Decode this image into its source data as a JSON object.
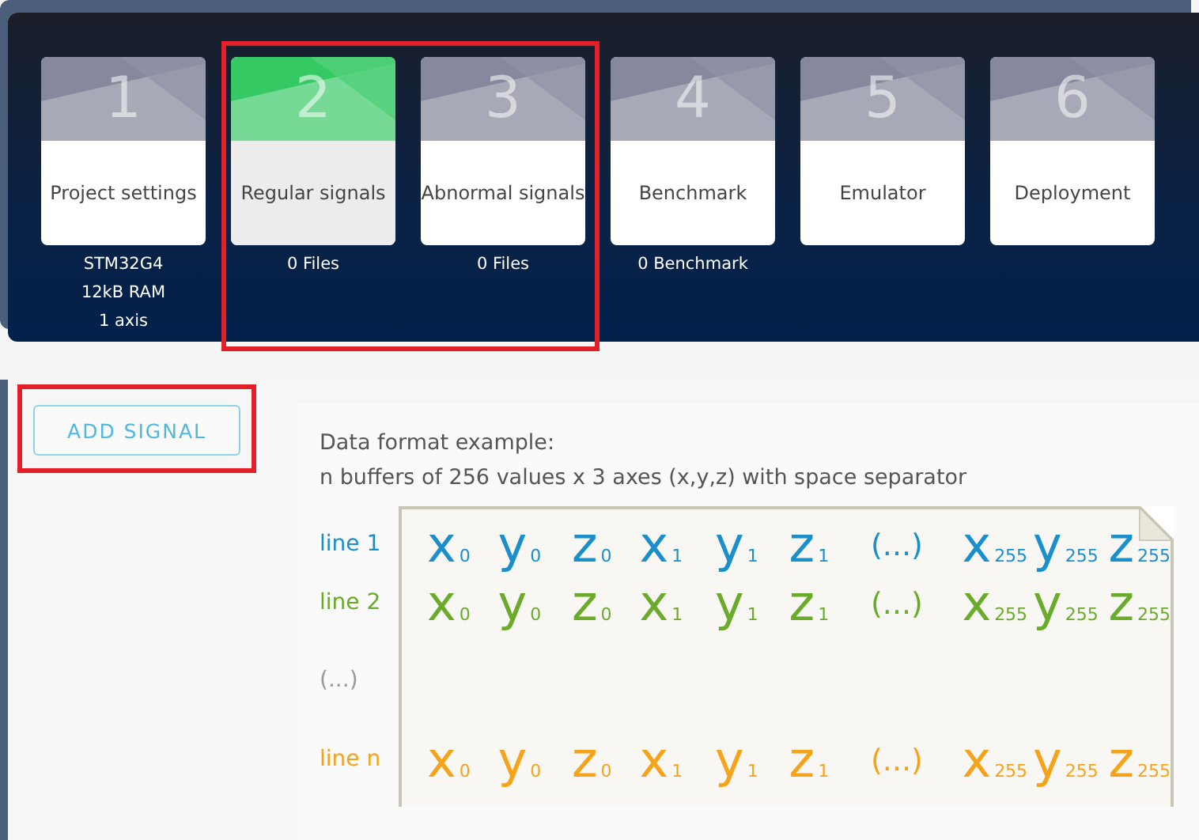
{
  "steps": [
    {
      "number": "1",
      "title": "Project settings",
      "selected": false,
      "highlighted": false,
      "details": [
        "STM32G4",
        "12kB RAM",
        "1 axis"
      ]
    },
    {
      "number": "2",
      "title": "Regular signals",
      "selected": true,
      "highlighted": true,
      "details": [
        "0 Files"
      ]
    },
    {
      "number": "3",
      "title": "Abnormal signals",
      "selected": false,
      "highlighted": true,
      "details": [
        "0 Files"
      ]
    },
    {
      "number": "4",
      "title": "Benchmark",
      "selected": false,
      "highlighted": false,
      "details": [
        "0 Benchmark"
      ]
    },
    {
      "number": "5",
      "title": "Emulator",
      "selected": false,
      "highlighted": false
    },
    {
      "number": "6",
      "title": "Deployment",
      "selected": false,
      "highlighted": false
    }
  ],
  "add_button": {
    "label": "ADD SIGNAL",
    "highlighted": true
  },
  "example": {
    "title": "Data format example:",
    "subtitle": "n buffers of 256 values x 3 axes (x,y,z) with space separator",
    "rows": [
      {
        "kind": "values",
        "label": "line 1",
        "color": "#1a8fcc",
        "cells": [
          {
            "base": "x",
            "sub": "0"
          },
          {
            "base": "y",
            "sub": "0"
          },
          {
            "base": "z",
            "sub": "0"
          },
          {
            "base": "x",
            "sub": "1"
          },
          {
            "base": "y",
            "sub": "1"
          },
          {
            "base": "z",
            "sub": "1"
          },
          {
            "base": "(...)"
          },
          {
            "base": "x",
            "sub": "255"
          },
          {
            "base": "y",
            "sub": "255"
          },
          {
            "base": "z",
            "sub": "255"
          }
        ]
      },
      {
        "kind": "values",
        "label": "line 2",
        "color": "#6aab2c",
        "cells": [
          {
            "base": "x",
            "sub": "0"
          },
          {
            "base": "y",
            "sub": "0"
          },
          {
            "base": "z",
            "sub": "0"
          },
          {
            "base": "x",
            "sub": "1"
          },
          {
            "base": "y",
            "sub": "1"
          },
          {
            "base": "z",
            "sub": "1"
          },
          {
            "base": "(...)"
          },
          {
            "base": "x",
            "sub": "255"
          },
          {
            "base": "y",
            "sub": "255"
          },
          {
            "base": "z",
            "sub": "255"
          }
        ]
      },
      {
        "kind": "gap",
        "label": "(...)",
        "color": "#9a9a9a"
      },
      {
        "kind": "values",
        "label": "line n",
        "color": "#f5a31a",
        "cells": [
          {
            "base": "x",
            "sub": "0"
          },
          {
            "base": "y",
            "sub": "0"
          },
          {
            "base": "z",
            "sub": "0"
          },
          {
            "base": "x",
            "sub": "1"
          },
          {
            "base": "y",
            "sub": "1"
          },
          {
            "base": "z",
            "sub": "1"
          },
          {
            "base": "(...)"
          },
          {
            "base": "x",
            "sub": "255"
          },
          {
            "base": "y",
            "sub": "255"
          },
          {
            "base": "z",
            "sub": "255"
          }
        ]
      }
    ]
  }
}
